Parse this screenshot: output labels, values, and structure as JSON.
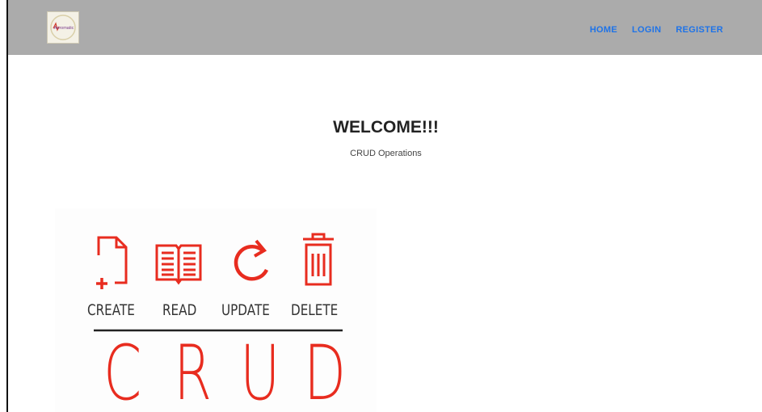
{
  "nav": {
    "logo_text": "Aeromatic",
    "links": [
      "HOME",
      "LOGIN",
      "REGISTER"
    ]
  },
  "hero": {
    "title": "WELCOME!!!",
    "subtitle": "CRUD Operations"
  },
  "crud_image": {
    "operations": [
      "CREATE",
      "READ",
      "UPDATE",
      "DELETE"
    ],
    "letters": [
      "C",
      "R",
      "U",
      "D"
    ],
    "accent_color": "#e82c1f",
    "icons": [
      "new-file-icon",
      "book-icon",
      "refresh-icon",
      "trash-icon"
    ]
  },
  "colors": {
    "navbar": "#ababab",
    "link": "#1e73e8"
  }
}
